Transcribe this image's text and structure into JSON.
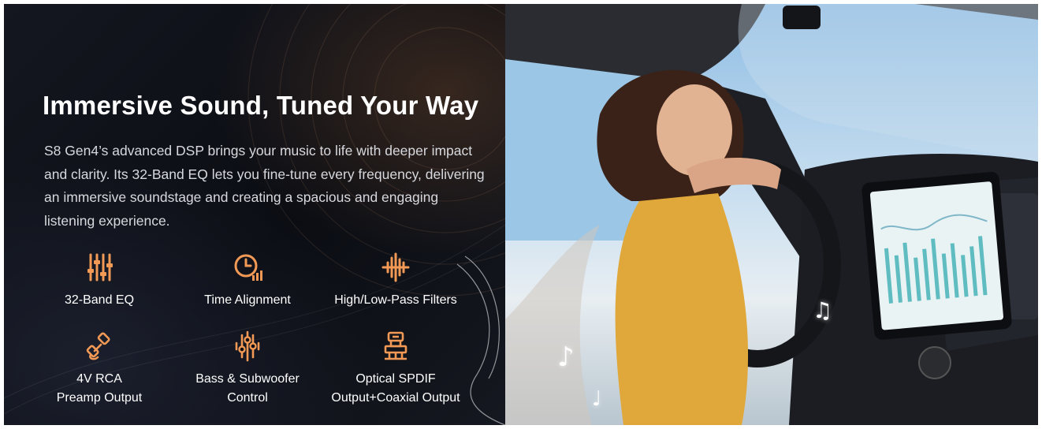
{
  "headline": "Immersive Sound, Tuned Your Way",
  "description": "S8 Gen4’s advanced DSP brings your music to life with deeper impact and clarity. Its 32-Band EQ lets you fine-tune every frequency, delivering an immersive soundstage and creating a spacious and engaging listening experience.",
  "features": [
    {
      "icon": "equalizer-sliders-icon",
      "line1": "32-Band EQ",
      "line2": ""
    },
    {
      "icon": "clock-chart-icon",
      "line1": "Time Alignment",
      "line2": ""
    },
    {
      "icon": "waveform-icon",
      "line1": "High/Low-Pass Filters",
      "line2": ""
    },
    {
      "icon": "rca-cable-icon",
      "line1": "4V RCA",
      "line2": "Preamp Output"
    },
    {
      "icon": "bass-sliders-icon",
      "line1": "Bass & Subwoofer",
      "line2": "Control"
    },
    {
      "icon": "optical-connector-icon",
      "line1": "Optical SPDIF",
      "line2": "Output+Coaxial Output"
    }
  ],
  "colors": {
    "accent": "#f29a55",
    "background": "#0c0e14",
    "text": "#ffffff",
    "body_text": "#d8d9de"
  },
  "music_notes": [
    "♪",
    "♩",
    "♫"
  ]
}
